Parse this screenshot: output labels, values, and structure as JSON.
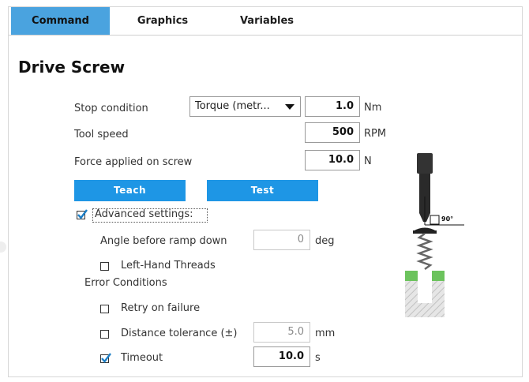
{
  "tabs": [
    {
      "label": "Command"
    },
    {
      "label": "Graphics"
    },
    {
      "label": "Variables"
    }
  ],
  "title": "Drive Screw",
  "stop_condition": {
    "label": "Stop condition",
    "selected": "Torque (metr...",
    "value": "1.0",
    "unit": "Nm"
  },
  "tool_speed": {
    "label": "Tool speed",
    "value": "500",
    "unit": "RPM"
  },
  "force": {
    "label": "Force applied on screw",
    "value": "10.0",
    "unit": "N"
  },
  "buttons": {
    "teach": "Teach",
    "test": "Test"
  },
  "advanced": {
    "label": "Advanced settings:",
    "checked": true
  },
  "angle": {
    "label": "Angle before ramp down",
    "value": "0",
    "unit": "deg"
  },
  "left_hand": {
    "label": "Left-Hand Threads",
    "checked": false
  },
  "error_conditions": {
    "label": "Error Conditions",
    "retry": {
      "label": "Retry on failure",
      "checked": false
    },
    "distance": {
      "label": "Distance tolerance (±)",
      "value": "5.0",
      "unit": "mm",
      "checked": false
    },
    "timeout": {
      "label": "Timeout",
      "value": "10.0",
      "unit": "s",
      "checked": true
    }
  },
  "illustration": {
    "angle_label": "90°"
  },
  "colors": {
    "tab_active": "#4aa3df",
    "button": "#1e96e5",
    "check": "#1e7fc6",
    "workpiece_green": "#6cc35d"
  }
}
